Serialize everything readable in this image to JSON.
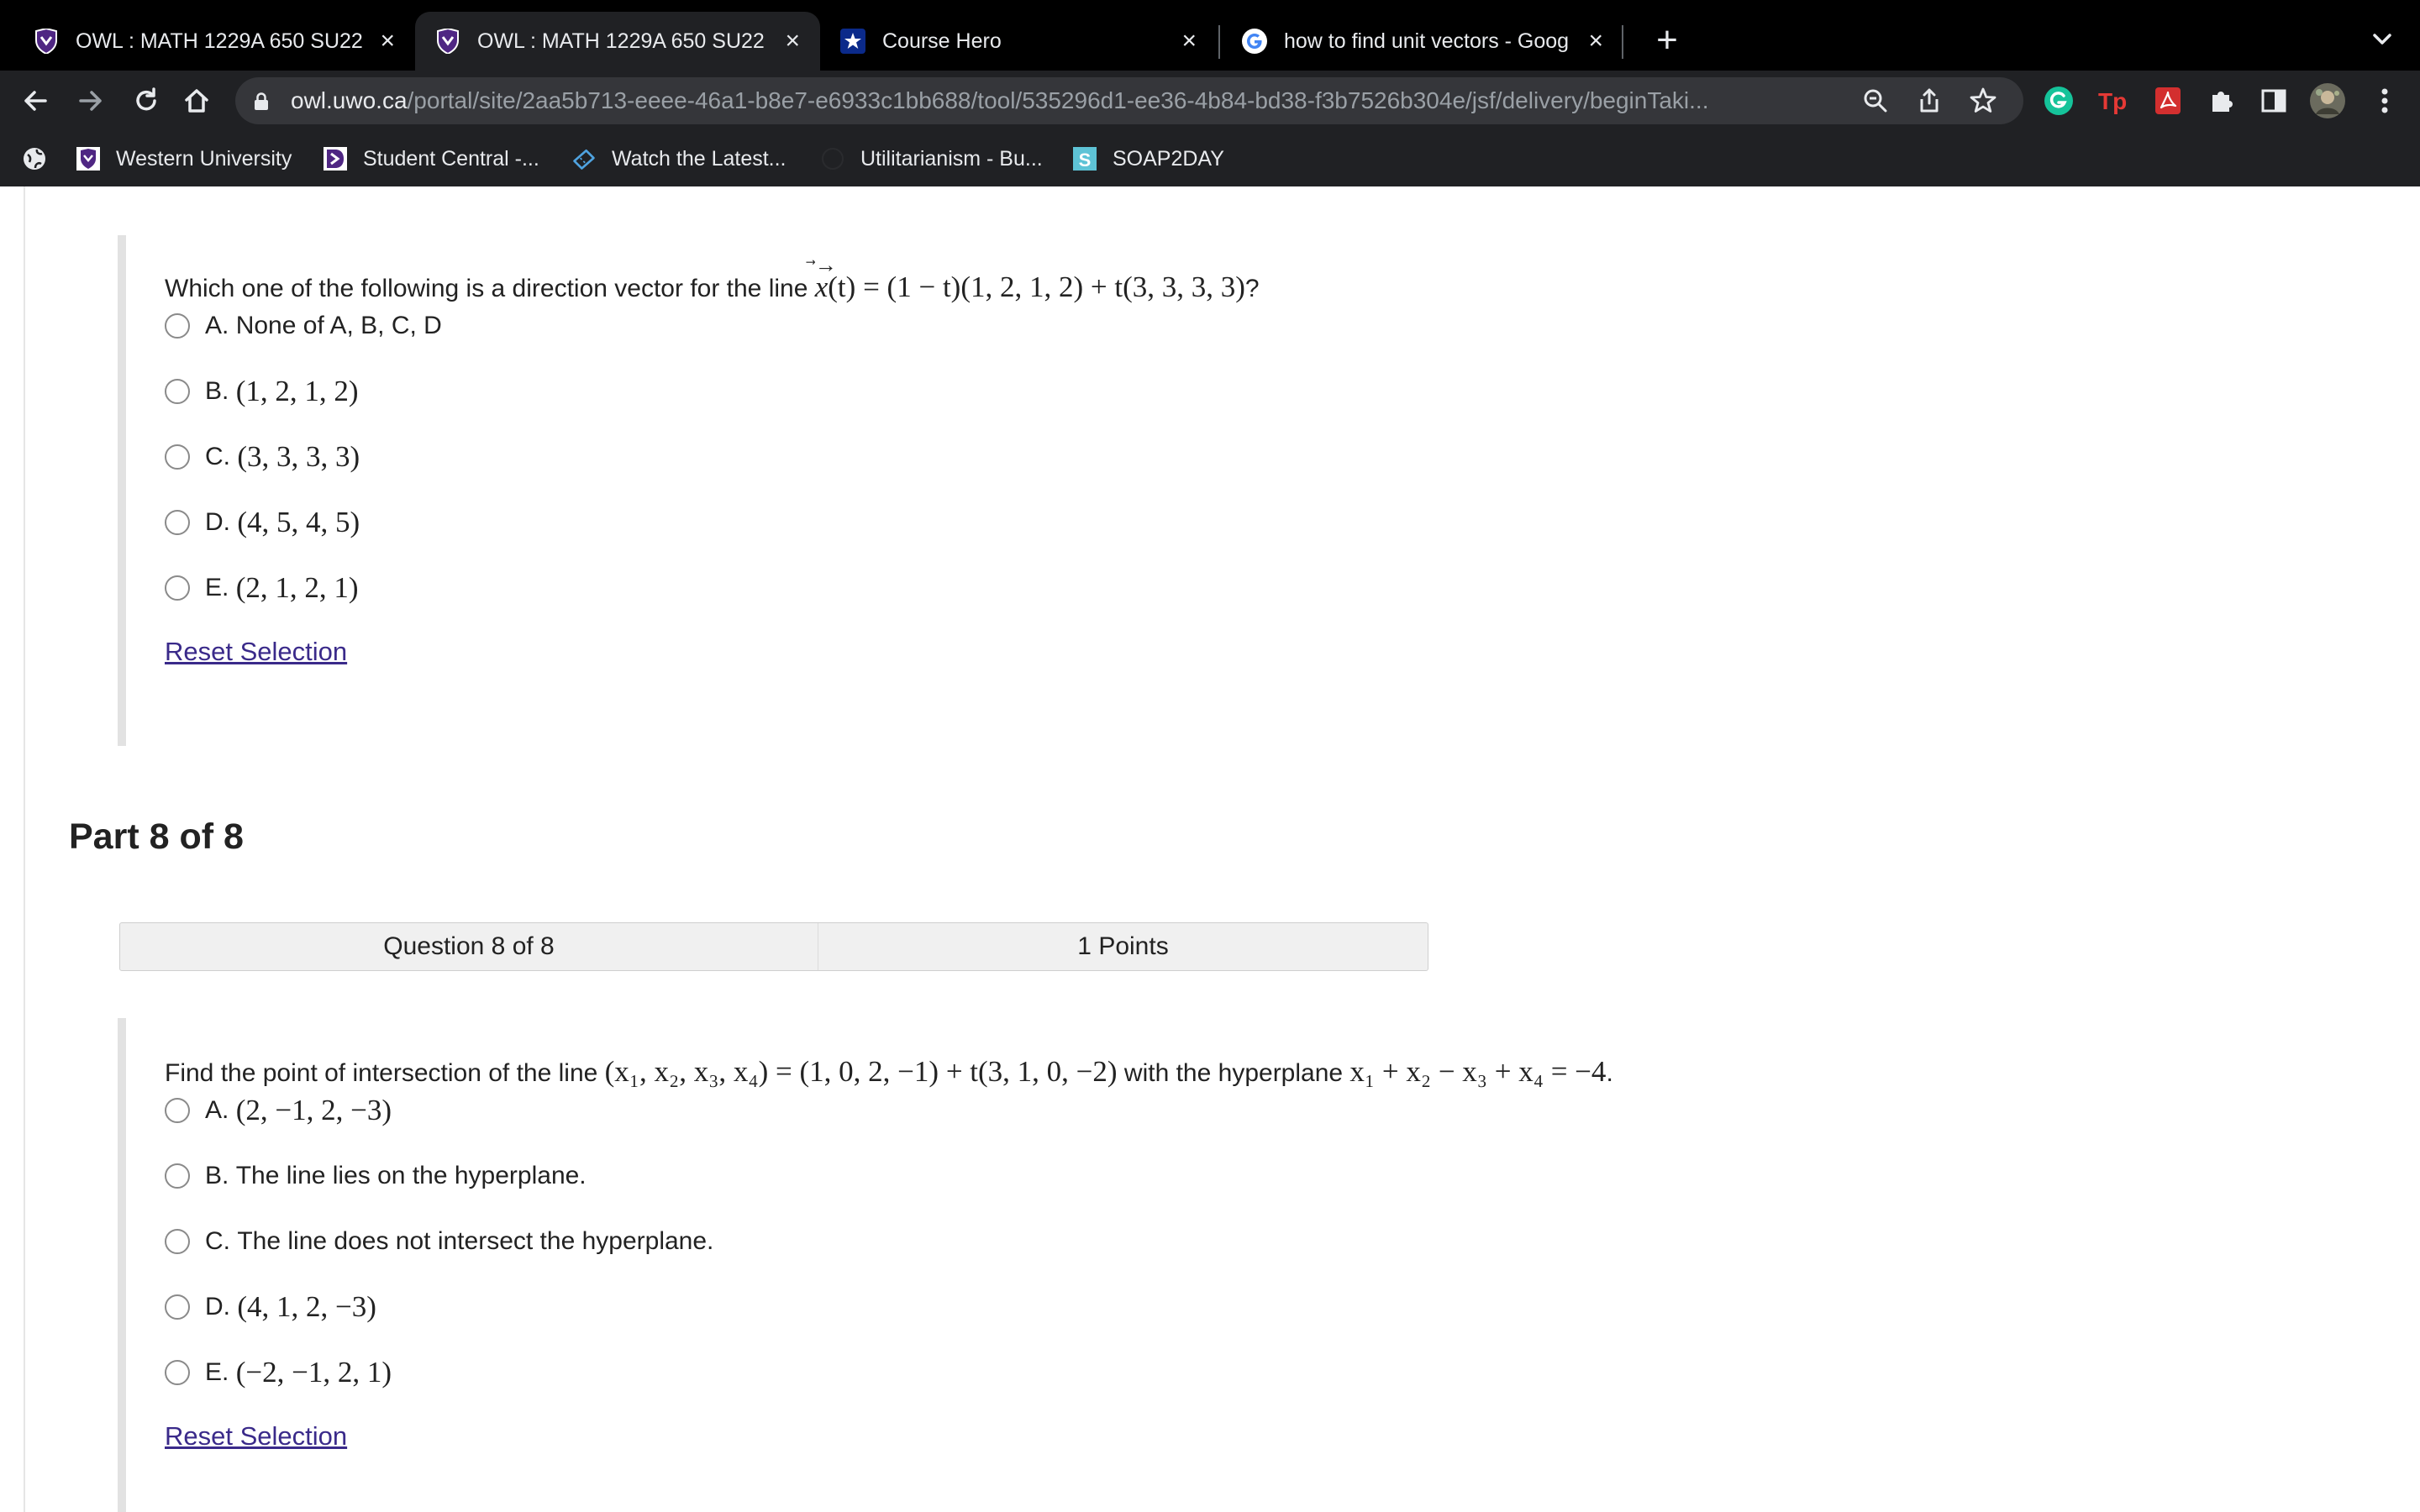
{
  "tabs": [
    {
      "title": "OWL : MATH 1229A 650 SU22",
      "favicon": "owl-shield-icon",
      "active": false
    },
    {
      "title": "OWL : MATH 1229A 650 SU22",
      "favicon": "owl-shield-icon",
      "active": true
    },
    {
      "title": "Course Hero",
      "favicon": "course-hero-star-icon",
      "active": false
    },
    {
      "title": "how to find unit vectors - Goog",
      "favicon": "google-icon",
      "active": false
    }
  ],
  "address_bar": {
    "host": "owl.uwo.ca",
    "path": "/portal/site/2aa5b713-eeee-46a1-b8e7-e6933c1bb688/tool/535296d1-ee36-4b84-bd38-f3b7526b304e/jsf/delivery/beginTaki..."
  },
  "bookmarks": [
    {
      "label": "Western University",
      "icon": "western-shield-icon"
    },
    {
      "label": "Student Central -...",
      "icon": "student-central-icon"
    },
    {
      "label": "Watch the Latest...",
      "icon": "ticket-icon"
    },
    {
      "label": "Utilitarianism - Bu...",
      "icon": "generic-page-icon"
    },
    {
      "label": "SOAP2DAY",
      "icon": "soap2day-icon",
      "badge": "S"
    }
  ],
  "q7": {
    "prompt_prefix": "Which one of the following is a direction vector for the line ",
    "prompt_math_head": "x",
    "prompt_math_tail": "(t) = (1 − t)(1, 2, 1, 2) + t(3, 3, 3, 3)",
    "prompt_suffix": "?",
    "options": [
      {
        "letter": "A.",
        "text": "None of A, B, C, D",
        "math": false
      },
      {
        "letter": "B.",
        "text": "(1, 2, 1, 2)",
        "math": true
      },
      {
        "letter": "C.",
        "text": "(3, 3, 3, 3)",
        "math": true
      },
      {
        "letter": "D.",
        "text": "(4, 5, 4, 5)",
        "math": true
      },
      {
        "letter": "E.",
        "text": "(2, 1, 2, 1)",
        "math": true
      }
    ],
    "reset": "Reset Selection"
  },
  "part8": {
    "title": "Part 8 of 8",
    "question_label": "Question 8 of 8",
    "points_label": "1 Points"
  },
  "q8": {
    "prompt_prefix": "Find the point of intersection of the line ",
    "prompt_math_line": "(x₁, x₂, x₃, x₄) = (1, 0, 2, −1) + t(3, 1, 0, −2)",
    "prompt_mid": " with the hyperplane ",
    "prompt_math_plane": "x₁ + x₂ − x₃ + x₄ = −4",
    "prompt_suffix": ".",
    "options": [
      {
        "letter": "A.",
        "text": "(2, −1, 2, −3)",
        "math": true
      },
      {
        "letter": "B.",
        "text": "The line lies on the hyperplane.",
        "math": false
      },
      {
        "letter": "C.",
        "text": "The line does not intersect the hyperplane.",
        "math": false
      },
      {
        "letter": "D.",
        "text": "(4, 1, 2, −3)",
        "math": true
      },
      {
        "letter": "E.",
        "text": "(−2, −1, 2, 1)",
        "math": true
      }
    ],
    "reset": "Reset Selection"
  }
}
